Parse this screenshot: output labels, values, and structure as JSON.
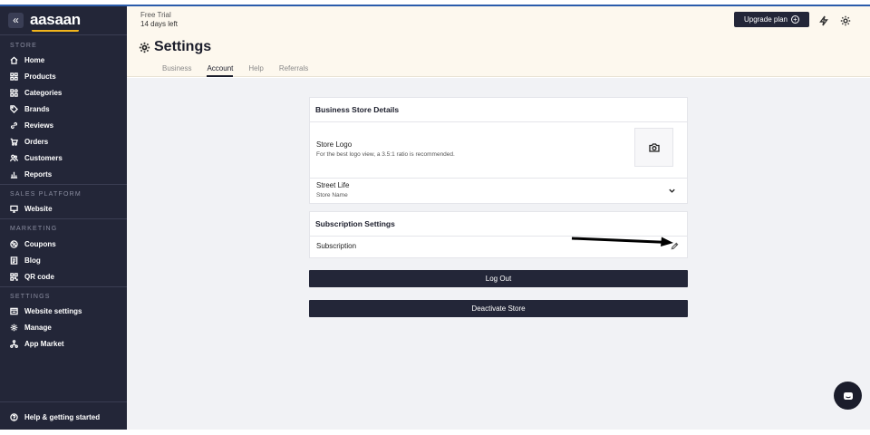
{
  "sidebar": {
    "brand": "aasaan",
    "collapse_glyph": "«",
    "sections": {
      "store": "STORE",
      "sales_platform": "SALES PLATFORM",
      "marketing": "MARKETING",
      "settings": "SETTINGS"
    },
    "items": {
      "home": "Home",
      "products": "Products",
      "categories": "Categories",
      "brands": "Brands",
      "reviews": "Reviews",
      "orders": "Orders",
      "customers": "Customers",
      "reports": "Reports",
      "website": "Website",
      "coupons": "Coupons",
      "blog": "Blog",
      "qr_code": "QR code",
      "website_settings": "Website settings",
      "manage": "Manage",
      "app_market": "App Market"
    },
    "help": "Help & getting started"
  },
  "header": {
    "trial_label": "Free Trial",
    "trial_days": "14 days left",
    "upgrade_label": "Upgrade plan",
    "upgrade_plus": "+",
    "title": "Settings",
    "tabs": {
      "business": "Business",
      "account": "Account",
      "help": "Help",
      "referrals": "Referrals"
    },
    "active_tab": "Account"
  },
  "business_card": {
    "title": "Business Store Details",
    "logo_label": "Store Logo",
    "logo_hint": "For the best logo view, a 3.5:1 ratio is recommended.",
    "store_name_value": "Street Life",
    "store_name_label": "Store Name"
  },
  "subscription_card": {
    "title": "Subscription Settings",
    "row_label": "Subscription"
  },
  "actions": {
    "logout": "Log Out",
    "deactivate": "Deactivate Store"
  },
  "colors": {
    "sidebar_bg": "#232638",
    "header_bg": "#fdf8ee",
    "main_bg": "#f1f2f5",
    "brand_accent": "#f2b51c",
    "button_dark": "#232638"
  },
  "icons": {
    "header": [
      "bolt-icon",
      "gear-icon"
    ],
    "logo_upload": "camera-icon",
    "edit": "pencil-icon",
    "chat": "chat-icon"
  }
}
